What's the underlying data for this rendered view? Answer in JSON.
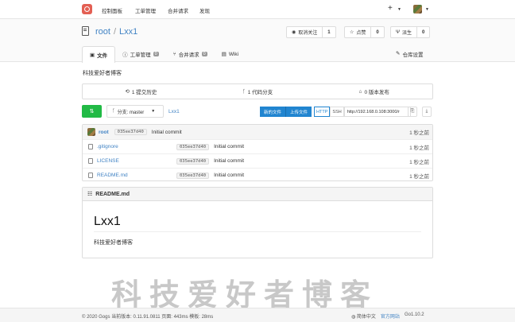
{
  "topbar": {
    "nav": [
      "控制面板",
      "工单管理",
      "合并请求",
      "发现"
    ],
    "plus": "+"
  },
  "repo": {
    "owner": "root",
    "sep": "/",
    "name": "Lxx1",
    "watch_label": "取消关注",
    "watch_count": "1",
    "star_label": "点赞",
    "star_count": "0",
    "fork_label": "派生",
    "fork_count": "0"
  },
  "tabs": [
    {
      "label": "文件",
      "icon": "code-icon"
    },
    {
      "label": "工单管理",
      "badge": "0",
      "icon": "issue-icon"
    },
    {
      "label": "合并请求",
      "badge": "0",
      "icon": "pr-icon"
    },
    {
      "label": "Wiki",
      "icon": "book-icon"
    }
  ],
  "settings_label": "仓库设置",
  "description": "科技爱好者博客",
  "stats": [
    "1 提交历史",
    "1 代码分支",
    "0 版本发布"
  ],
  "branch": {
    "label": "分支: master"
  },
  "crumb": "Lxx1",
  "clone": {
    "new_file": "新的文件",
    "upload": "上传文件",
    "http": "HTTP",
    "ssh": "SSH",
    "url": "http://192.168.0.108:3000/r"
  },
  "latest_commit": {
    "author": "root",
    "sha": "035ee37d40",
    "message": "Initial commit",
    "time": "1 秒之前"
  },
  "files": [
    {
      "name": ".gitignore",
      "sha": "035ee37d40",
      "message": "Initial commit",
      "time": "1 秒之前"
    },
    {
      "name": "LICENSE",
      "sha": "035ee37d40",
      "message": "Initial commit",
      "time": "1 秒之前"
    },
    {
      "name": "README.md",
      "sha": "035ee37d40",
      "message": "Initial commit",
      "time": "1 秒之前"
    }
  ],
  "readme": {
    "filename": "README.md",
    "h1": "Lxx1",
    "text": "科技爱好者博客"
  },
  "watermark": "科技爱好者博客",
  "footer": {
    "left": "© 2020 Gogs 当前版本: 0.11.91.0811 页面: 443ms 模板: 28ms",
    "lang": "简体中文",
    "site": "官方网站",
    "go": "Go1.10.2"
  }
}
